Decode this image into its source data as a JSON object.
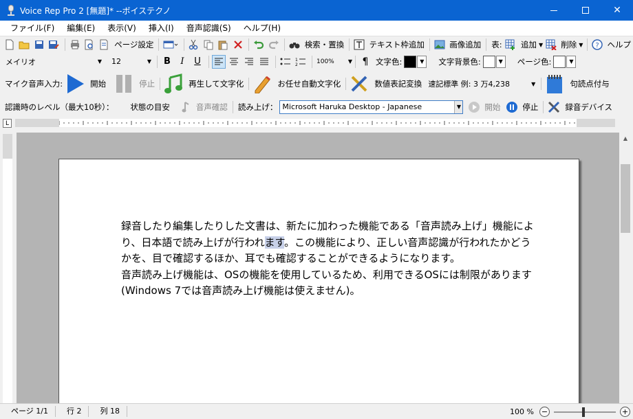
{
  "window": {
    "title": "Voice Rep Pro 2 [無題]* --ボイステクノ",
    "min": "—",
    "close": "✕"
  },
  "menu": [
    "ファイル(F)",
    "編集(E)",
    "表示(V)",
    "挿入(I)",
    "音声認識(S)",
    "ヘルプ(H)"
  ],
  "toolbar1": {
    "page_setup": "ページ設定",
    "search_replace": "検索・置換",
    "text_frame": "テキスト枠追加",
    "image_add": "画像追加",
    "table_label": "表:",
    "table_add": "追加",
    "table_delete": "削除",
    "help": "ヘルプ"
  },
  "toolbar2": {
    "font_name": "メイリオ",
    "font_size": "12",
    "bold": "B",
    "italic": "I",
    "underline": "U",
    "line_spacing": "100%",
    "paragraph_mark": "¶",
    "text_color_label": "文字色:",
    "text_color": "#000000",
    "text_bg_label": "文字背景色:",
    "text_bg_color": "#ffffff",
    "page_color_label": "ページ色:",
    "page_color": "#ffffff"
  },
  "toolbar3": {
    "mic_label": "マイク音声入力:",
    "start": "開始",
    "stop": "停止",
    "playback_transcribe": "再生して文字化",
    "auto_transcribe": "お任せ自動文字化",
    "numeric_convert": "数値表記変換",
    "numeric_mode": "速記標準 例: 3 万4,238",
    "punctuation": "句読点付与"
  },
  "toolbar4": {
    "level_label": "認識時のレベル（最大10秒）：",
    "state_guide": "状態の目安",
    "voice_confirm": "音声確認",
    "read_label": "読み上げ：",
    "voice_select": "Microsoft Haruka Desktop - Japanese",
    "start": "開始",
    "stop": "停止",
    "rec_device": "録音デバイス"
  },
  "document": {
    "seg1": "録音したり編集したりした文書は、新たに加わった機能である「音声読み上げ」機能により、日本語で読み上げが行われ",
    "seg_highlight": "ます",
    "seg2": "。この機能により、正しい音声認識が行われたかどうかを、目で確認するほか、耳でも確認することができるようになります。",
    "para2": "音声読み上げ機能は、OSの機能を使用しているため、利用できるOSには制限があります(Windows 7では音声読み上げ機能は使えません)。"
  },
  "status": {
    "page": "ページ 1/1",
    "line": "行 2",
    "col": "列 18",
    "zoom": "100 %",
    "zoom_level_percent": 100
  }
}
